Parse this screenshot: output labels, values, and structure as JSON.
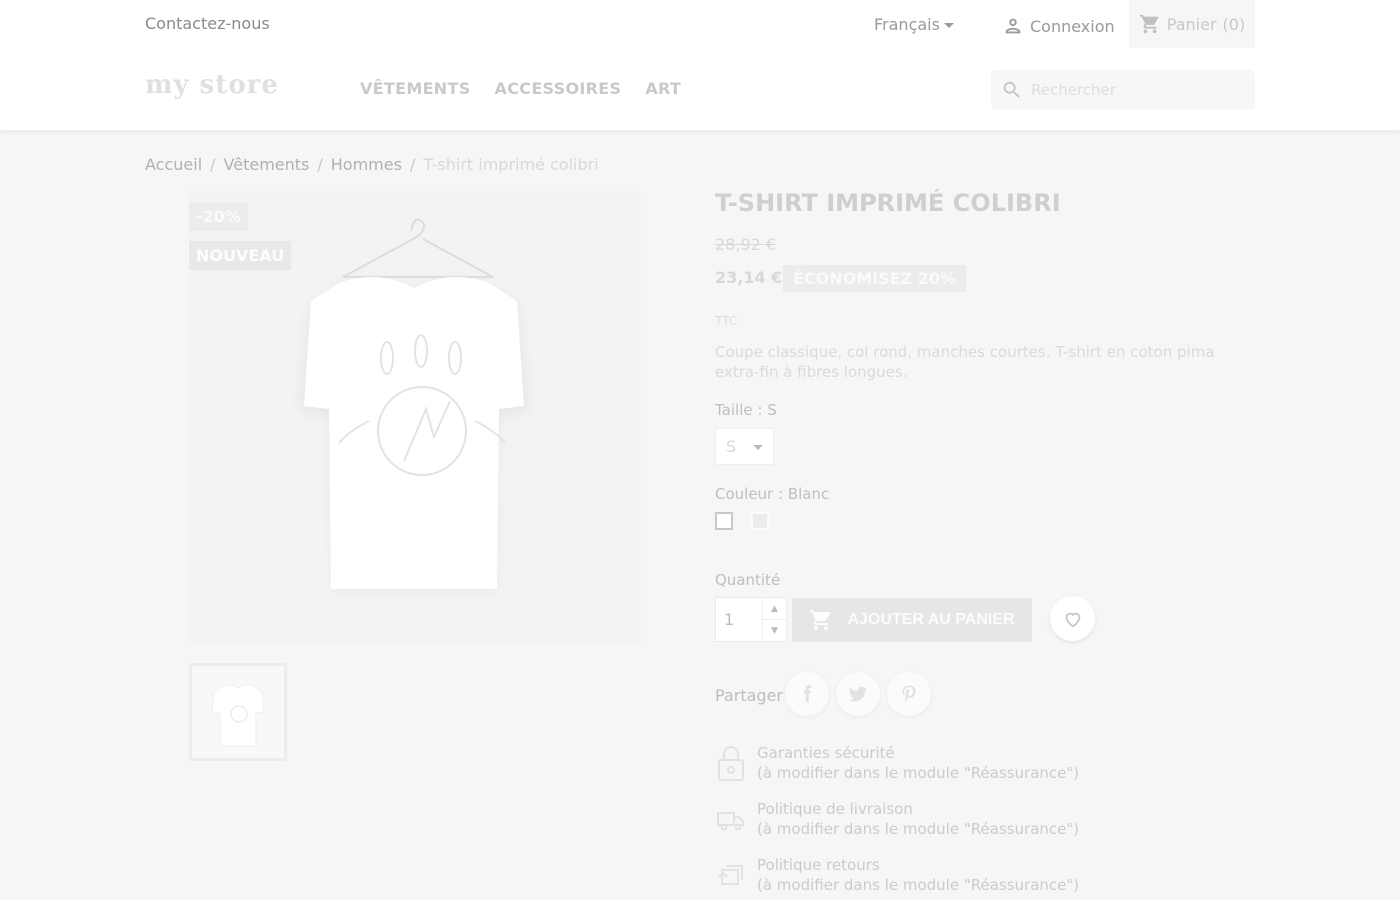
{
  "header": {
    "contact_label": "Contactez-nous",
    "language_label": "Français",
    "login_label": "Connexion",
    "cart_label": "Panier",
    "cart_count": "(0)",
    "logo_text": "my store",
    "nav": [
      {
        "label": "VÊTEMENTS"
      },
      {
        "label": "ACCESSOIRES"
      },
      {
        "label": "ART"
      }
    ],
    "search_placeholder": "Rechercher"
  },
  "breadcrumb": [
    "Accueil",
    "Vêtements",
    "Hommes",
    "T-shirt imprimé colibri"
  ],
  "product": {
    "badges": {
      "discount": "-20%",
      "new": "NOUVEAU"
    },
    "title": "T-SHIRT IMPRIMÉ COLIBRI",
    "old_price": "28,92 €",
    "price": "23,14 €",
    "savings_label": "ÉCONOMISEZ 20%",
    "tax_label": "TTC",
    "description": "Coupe classique, col rond, manches courtes. T-shirt en coton pima extra-fin à fibres longues.",
    "size_label": "Taille : S",
    "size_value": "S",
    "color_label": "Couleur : Blanc",
    "colors": [
      {
        "name": "Blanc",
        "hex": "#ffffff"
      },
      {
        "name": "Gris",
        "hex": "#ececec"
      }
    ],
    "quantity_label": "Quantité",
    "quantity_value": "1",
    "add_to_cart_label": "AJOUTER AU PANIER",
    "share_label": "Partager"
  },
  "reassurance": [
    {
      "icon": "lock-icon",
      "title": "Garanties sécurité",
      "subtitle": "(à modifier dans le module \"Réassurance\")"
    },
    {
      "icon": "truck-icon",
      "title": "Politique de livraison",
      "subtitle": "(à modifier dans le module \"Réassurance\")"
    },
    {
      "icon": "return-icon",
      "title": "Politique retours",
      "subtitle": "(à modifier dans le module \"Réassurance\")"
    }
  ]
}
